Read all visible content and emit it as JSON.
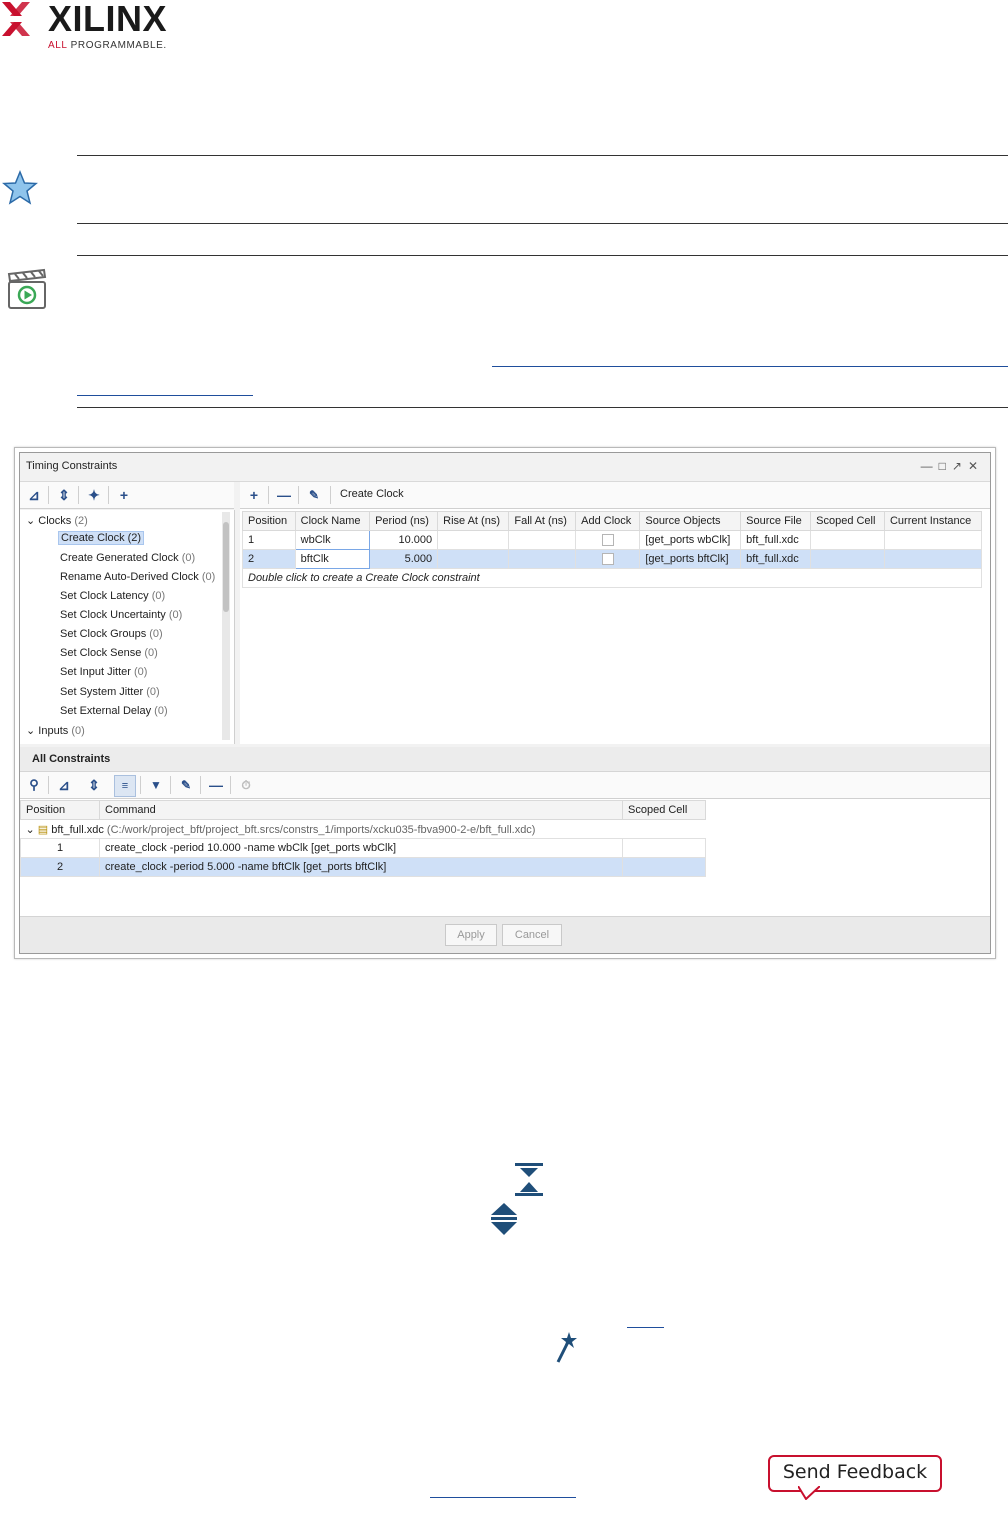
{
  "logo": {
    "word": "XILINX",
    "tag_prefix": "ALL",
    "tag_rest": "PROGRAMMABLE."
  },
  "window": {
    "title": "Timing Constraints",
    "tree": {
      "root": {
        "label": "Clocks",
        "count": "(2)"
      },
      "items": [
        {
          "label": "Create Clock",
          "count": "(2)"
        },
        {
          "label": "Create Generated Clock",
          "count": "(0)"
        },
        {
          "label": "Rename Auto-Derived Clock",
          "count": "(0)"
        },
        {
          "label": "Set Clock Latency",
          "count": "(0)"
        },
        {
          "label": "Set Clock Uncertainty",
          "count": "(0)"
        },
        {
          "label": "Set Clock Groups",
          "count": "(0)"
        },
        {
          "label": "Set Clock Sense",
          "count": "(0)"
        },
        {
          "label": "Set Input Jitter",
          "count": "(0)"
        },
        {
          "label": "Set System Jitter",
          "count": "(0)"
        },
        {
          "label": "Set External Delay",
          "count": "(0)"
        }
      ],
      "next_group": {
        "label": "Inputs",
        "count": "(0)"
      }
    },
    "right_toolbar_label": "Create Clock",
    "clock_table": {
      "headers": [
        "Position",
        "Clock Name",
        "Period (ns)",
        "Rise At (ns)",
        "Fall At (ns)",
        "Add Clock",
        "Source Objects",
        "Source File",
        "Scoped Cell",
        "Current Instance"
      ],
      "rows": [
        {
          "position": "1",
          "name": "wbClk",
          "period": "10.000",
          "source": "[get_ports wbClk]",
          "file": "bft_full.xdc"
        },
        {
          "position": "2",
          "name": "bftClk",
          "period": "5.000",
          "source": "[get_ports bftClk]",
          "file": "bft_full.xdc"
        }
      ],
      "hint": "Double click to create a Create Clock constraint"
    },
    "all_constraints": {
      "title": "All Constraints",
      "headers": [
        "Position",
        "Command",
        "Scoped Cell"
      ],
      "file_name": "bft_full.xdc",
      "file_path": "(C:/work/project_bft/project_bft.srcs/constrs_1/imports/xcku035-fbva900-2-e/bft_full.xdc)",
      "rows": [
        {
          "position": "1",
          "command": "create_clock -period 10.000 -name wbClk [get_ports wbClk]"
        },
        {
          "position": "2",
          "command": "create_clock -period 5.000 -name bftClk [get_ports bftClk]"
        }
      ]
    },
    "buttons": {
      "apply": "Apply",
      "cancel": "Cancel"
    }
  },
  "feedback": {
    "label": "Send Feedback"
  },
  "colors": {
    "accent_blue": "#2a4f8a",
    "selection": "#cfe0f7",
    "xilinx_red": "#c8102e"
  }
}
